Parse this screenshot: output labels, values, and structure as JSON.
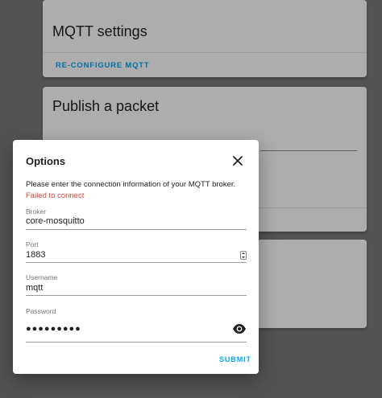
{
  "background": {
    "mqtt_settings_card": {
      "title": "MQTT settings",
      "action_label": "RE-CONFIGURE MQTT"
    },
    "publish_card": {
      "title": "Publish a packet"
    }
  },
  "dialog": {
    "title": "Options",
    "close_icon": "close-icon",
    "description": "Please enter the connection information of your MQTT broker.",
    "error": "Failed to connect",
    "fields": {
      "broker": {
        "label": "Broker",
        "value": "core-mosquitto"
      },
      "port": {
        "label": "Port",
        "value": "1883"
      },
      "username": {
        "label": "Username",
        "value": "mqtt"
      },
      "password": {
        "label": "Password",
        "value": "●●●●●●●●●"
      }
    },
    "password_toggle_icon": "eye-icon",
    "submit_label": "SUBMIT"
  },
  "colors": {
    "accent": "#03a9f4",
    "error": "#db4437"
  }
}
